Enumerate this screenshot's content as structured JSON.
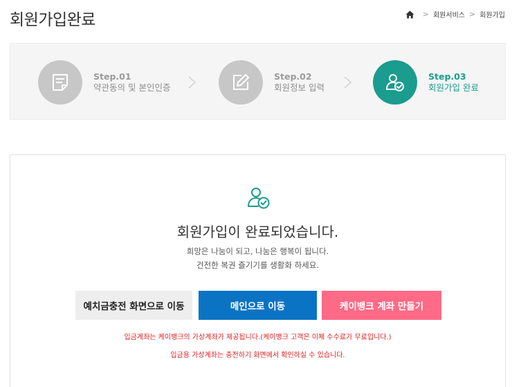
{
  "header": {
    "title": "회원가입완료",
    "breadcrumb": [
      "회원서비스",
      "회원가입"
    ]
  },
  "steps": [
    {
      "num": "Step.01",
      "label": "약관동의 및 본인인증",
      "icon": "document-icon",
      "active": false
    },
    {
      "num": "Step.02",
      "label": "회원정보 입력",
      "icon": "edit-icon",
      "active": false
    },
    {
      "num": "Step.03",
      "label": "회원가입 완료",
      "icon": "user-check-icon",
      "active": true
    }
  ],
  "content": {
    "message": "회원가입이 완료되었습니다.",
    "sub_line1": "희망은 나눔이 되고, 나눔은 행복이 됩니다.",
    "sub_line2": "건전한 복권 즐기기를 생활화 하세요.",
    "buttons": {
      "deposit": "예치금충전 화면으로 이동",
      "main": "메인으로 이동",
      "kbank": "케이뱅크 계좌 만들기"
    },
    "notice1": "입금계좌는 케이뱅크의 가상계좌가 제공됩니다.(케이뱅크 고객은 이체 수수료가 무료입니다.)",
    "notice2": "입금용 가상계좌는 충전하기 화면에서 확인하실 수 있습니다."
  },
  "colors": {
    "accent": "#1a9c8e",
    "inactive": "#c7c7c7",
    "main_button": "#0b73c4",
    "kbank_button": "#ff6a86",
    "notice": "#e02020"
  }
}
